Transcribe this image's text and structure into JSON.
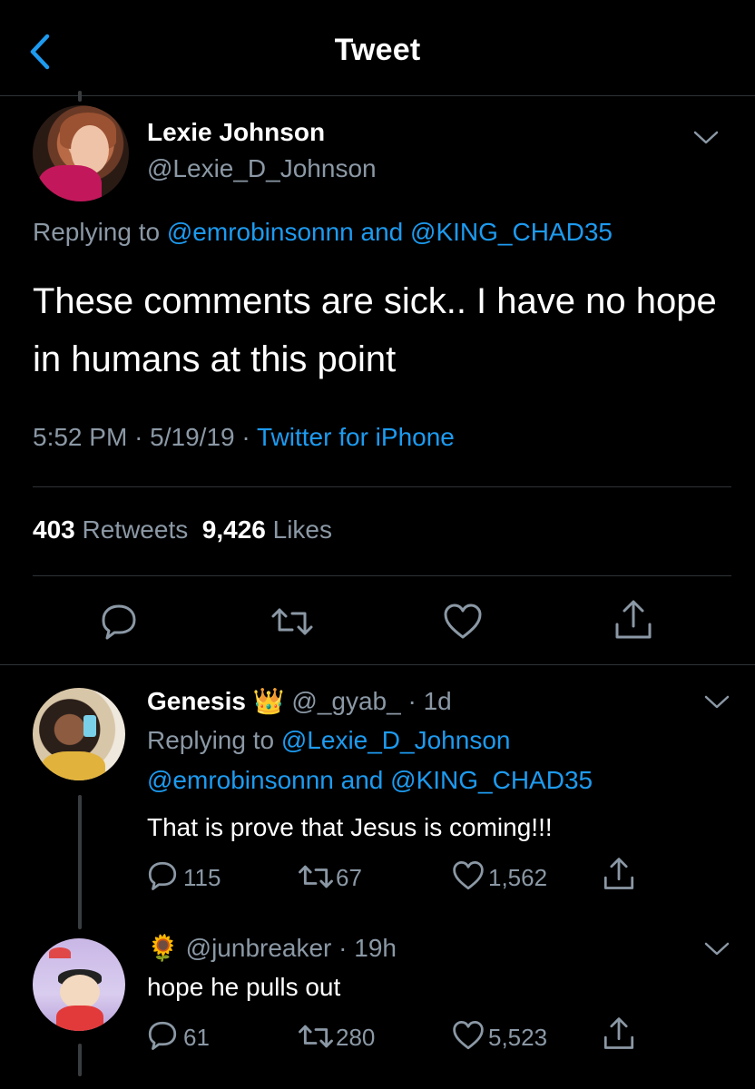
{
  "header": {
    "title": "Tweet"
  },
  "main_tweet": {
    "name": "Lexie Johnson",
    "handle": "@Lexie_D_Johnson",
    "replying_prefix": "Replying to",
    "reply_to_1": "@emrobinsonnn",
    "reply_and": "and",
    "reply_to_2": "@KING_CHAD35",
    "text": "These comments are sick.. I have no hope in humans at this point",
    "time": "5:52 PM",
    "date": "5/19/19",
    "separator": "·",
    "source": "Twitter for iPhone",
    "retweets_count": "403",
    "retweets_label": "Retweets",
    "likes_count": "9,426",
    "likes_label": "Likes"
  },
  "replies": [
    {
      "name": "Genesis",
      "badge": "👑",
      "handle": "@_gyab_",
      "age": "· 1d",
      "replying_prefix": "Replying to",
      "reply_to_1": "@Lexie_D_Johnson",
      "reply_to_2": "@emrobinsonnn",
      "reply_and": "and",
      "reply_to_3": "@KING_CHAD35",
      "text": "That is prove that Jesus is coming!!!",
      "replies_count": "115",
      "retweets_count": "67",
      "likes_count": "1,562"
    },
    {
      "badge": "🌻",
      "handle": "@junbreaker",
      "age": "· 19h",
      "text": "hope he pulls out",
      "replies_count": "61",
      "retweets_count": "280",
      "likes_count": "5,523"
    }
  ],
  "colors": {
    "background": "#000000",
    "accent": "#1d9bf0",
    "muted": "#8b98a5",
    "divider": "#2f3336"
  },
  "icons": [
    "back-chevron-icon",
    "reply-icon",
    "retweet-icon",
    "like-icon",
    "share-icon",
    "more-chevron-icon"
  ]
}
